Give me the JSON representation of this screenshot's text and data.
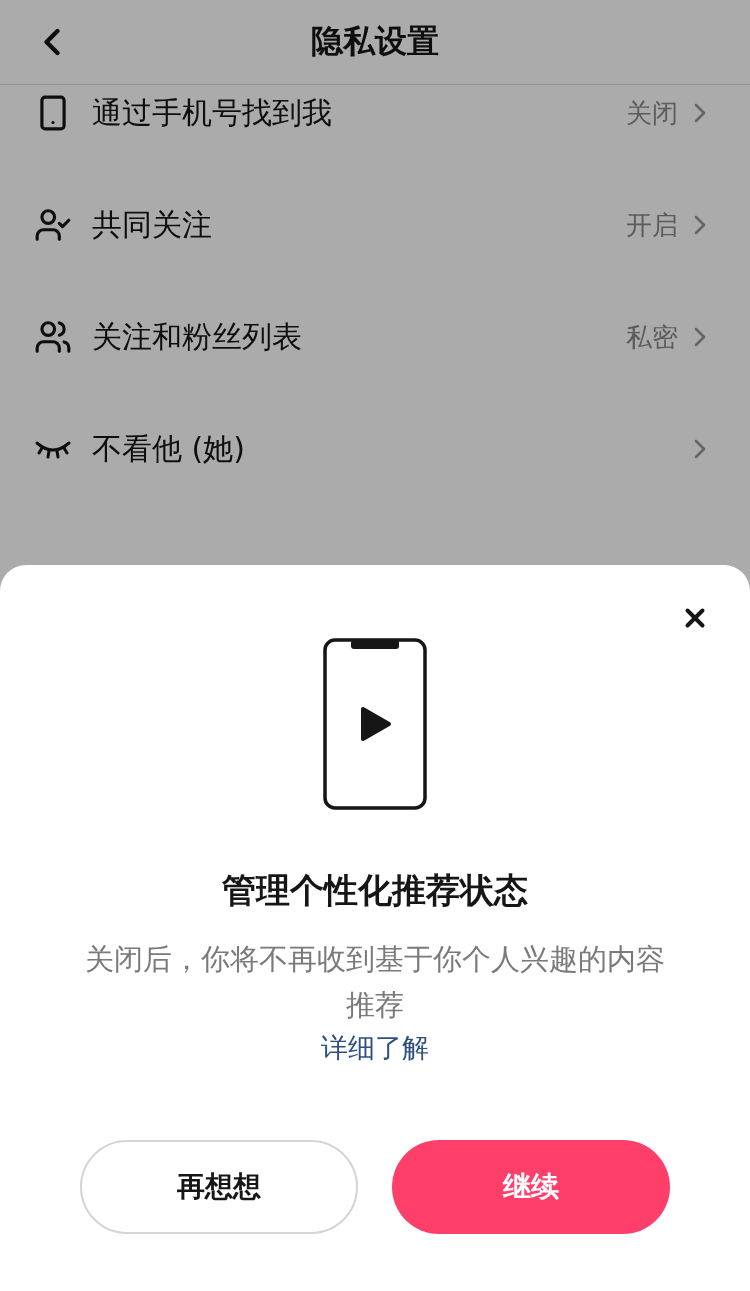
{
  "header": {
    "title": "隐私设置"
  },
  "settings": [
    {
      "kind": "phone",
      "label": "通过手机号找到我",
      "value": "关闭"
    },
    {
      "kind": "person-check",
      "label": "共同关注",
      "value": "开启"
    },
    {
      "kind": "people",
      "label": "关注和粉丝列表",
      "value": "私密"
    },
    {
      "kind": "closed-eye",
      "label": "不看他 (她)"
    }
  ],
  "sheet": {
    "title": "管理个性化推荐状态",
    "description": "关闭后，你将不再收到基于你个人兴趣的内容推荐",
    "link": "详细了解",
    "buttons": [
      {
        "kind": "secondary",
        "label": "再想想"
      },
      {
        "kind": "primary",
        "label": "继续"
      }
    ]
  }
}
